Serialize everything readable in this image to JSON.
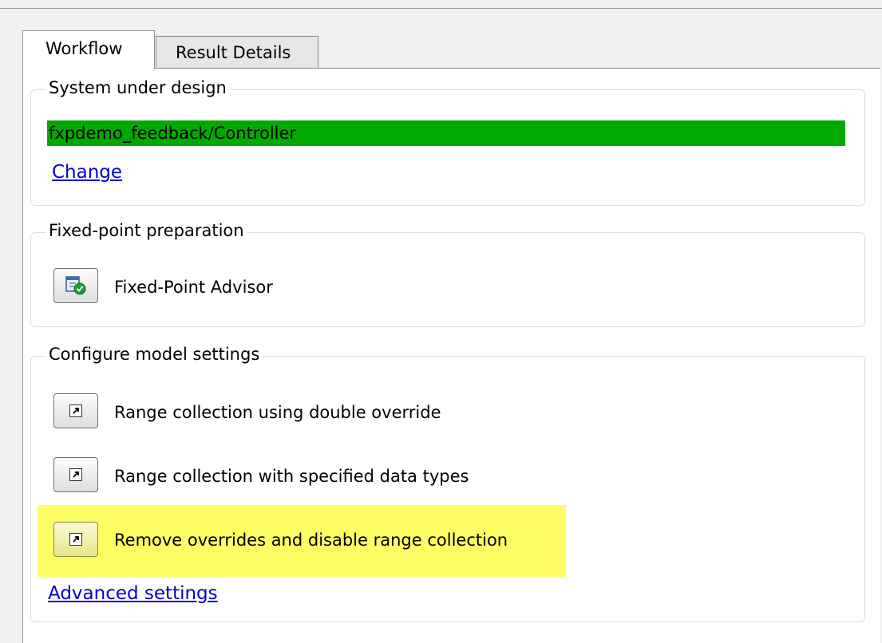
{
  "tabs": [
    {
      "label": "Workflow",
      "active": true
    },
    {
      "label": "Result Details",
      "active": false
    }
  ],
  "system_under_design": {
    "legend": "System under design",
    "value": "fxpdemo_feedback/Controller",
    "highlight_color": "#00aa00",
    "change_link": "Change"
  },
  "fixed_point_preparation": {
    "legend": "Fixed-point preparation",
    "advisor_button_label": "Fixed-Point Advisor",
    "advisor_icon": "fixed-point-advisor-icon"
  },
  "configure_model_settings": {
    "legend": "Configure model settings",
    "actions": [
      {
        "label": "Range collection using double override",
        "icon": "shortcut-arrow-icon",
        "highlighted": false
      },
      {
        "label": "Range collection with specified data types",
        "icon": "shortcut-arrow-icon",
        "highlighted": false
      },
      {
        "label": "Remove overrides and disable range collection",
        "icon": "shortcut-arrow-icon",
        "highlighted": true
      }
    ],
    "highlight_color": "#fcfc63",
    "advanced_link": "Advanced settings"
  }
}
